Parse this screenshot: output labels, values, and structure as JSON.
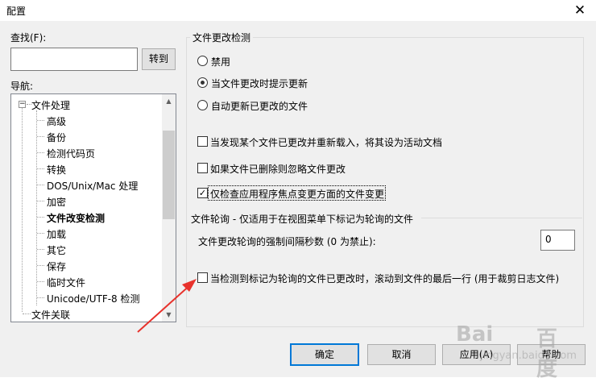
{
  "window": {
    "title": "配置"
  },
  "left": {
    "find_label": "查找(F):",
    "find_value": "",
    "goto_button": "转到",
    "nav_label": "导航:"
  },
  "tree": {
    "root_label": "文件处理",
    "children": [
      "高级",
      "备份",
      "检测代码页",
      "转换",
      "DOS/Unix/Mac 处理",
      "加密",
      "文件改变检测",
      "加载",
      "其它",
      "保存",
      "临时文件",
      "Unicode/UTF-8 检测"
    ],
    "selected": "文件改变检测",
    "next_root_label": "文件关联"
  },
  "file_change": {
    "group_title": "文件更改检测",
    "radios": [
      {
        "label": "禁用",
        "checked": false
      },
      {
        "label": "当文件更改时提示更新",
        "checked": true
      },
      {
        "label": "自动更新已更改的文件",
        "checked": false
      }
    ],
    "checkboxes": [
      {
        "label": "当发现某个文件已更改并重新载入，将其设为活动文档",
        "checked": false
      },
      {
        "label": "如果文件已删除则忽略文件更改",
        "checked": false
      },
      {
        "label": "仅检查应用程序焦点变更方面的文件变更",
        "checked": true
      }
    ]
  },
  "polling": {
    "group_title": "文件轮询 - 仅适用于在视图菜单下标记为轮询的文件",
    "interval_label": "文件更改轮询的强制间隔秒数 (0 为禁止):",
    "interval_value": "0",
    "scroll_label": "当检测到标记为轮询的文件已更改时，滚动到文件的最后一行 (用于裁剪日志文件)",
    "scroll_checked": false
  },
  "buttons": {
    "ok": "确定",
    "cancel": "取消",
    "apply": "应用(A)",
    "help": "帮助"
  },
  "annotation": {
    "color": "#e8322c"
  },
  "watermark": {
    "text": "Bai",
    "text2": "百度",
    "sub": "jingyan.baidu.com"
  }
}
